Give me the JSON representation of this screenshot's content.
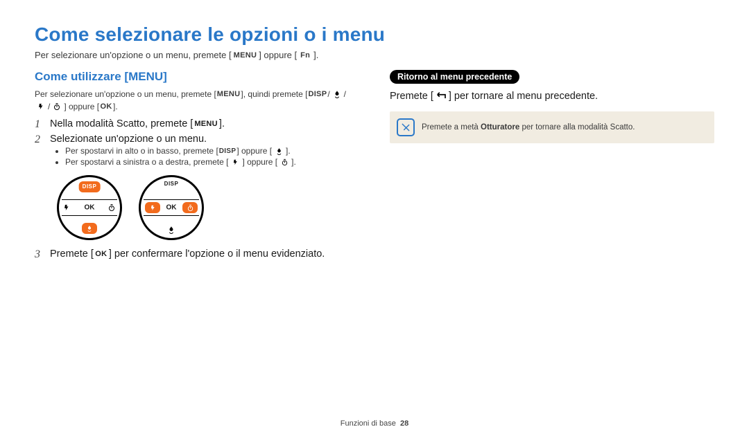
{
  "title": "Come selezionare le opzioni o i menu",
  "intro": {
    "pre": "Per selezionare un'opzione o un menu, premete [",
    "menu": "MENU",
    "mid": "] oppure [",
    "fn": "Fn",
    "post": "]."
  },
  "left": {
    "heading": "Come utilizzare [MENU]",
    "subintro": {
      "l1_pre": "Per selezionare un'opzione o un menu, premete [",
      "l1_menu": "MENU",
      "l1_mid": "], quindi premete [",
      "l1_disp": "DISP",
      "l1_slash1": "/",
      "l1_slash2": "/",
      "l2_slash": "/",
      "l2_mid": "] oppure [",
      "l2_ok": "OK",
      "l2_post": "]."
    },
    "steps": {
      "s1_pre": "Nella modalità Scatto, premete [",
      "s1_menu": "MENU",
      "s1_post": "].",
      "s2": "Selezionate un'opzione o un menu.",
      "s2_sub": {
        "a_pre": "Per spostarvi in alto o in basso, premete [",
        "a_disp": "DISP",
        "a_mid": "] oppure [",
        "a_post": "].",
        "b_pre": "Per spostarvi a sinistra o a destra, premete [",
        "b_mid": "] oppure [",
        "b_post": "]."
      },
      "s3_pre": "Premete [",
      "s3_ok": "OK",
      "s3_post": "] per confermare l'opzione o il menu evidenziato."
    },
    "dial": {
      "disp": "DISP",
      "ok": "OK"
    }
  },
  "right": {
    "badge": "Ritorno al menu precedente",
    "body_pre": "Premete [",
    "body_post": "] per tornare al menu precedente.",
    "note_pre": "Premete a metà ",
    "note_bold": "Otturatore",
    "note_post": " per tornare alla modalità Scatto."
  },
  "footer": {
    "label": "Funzioni di base",
    "page": "28"
  }
}
